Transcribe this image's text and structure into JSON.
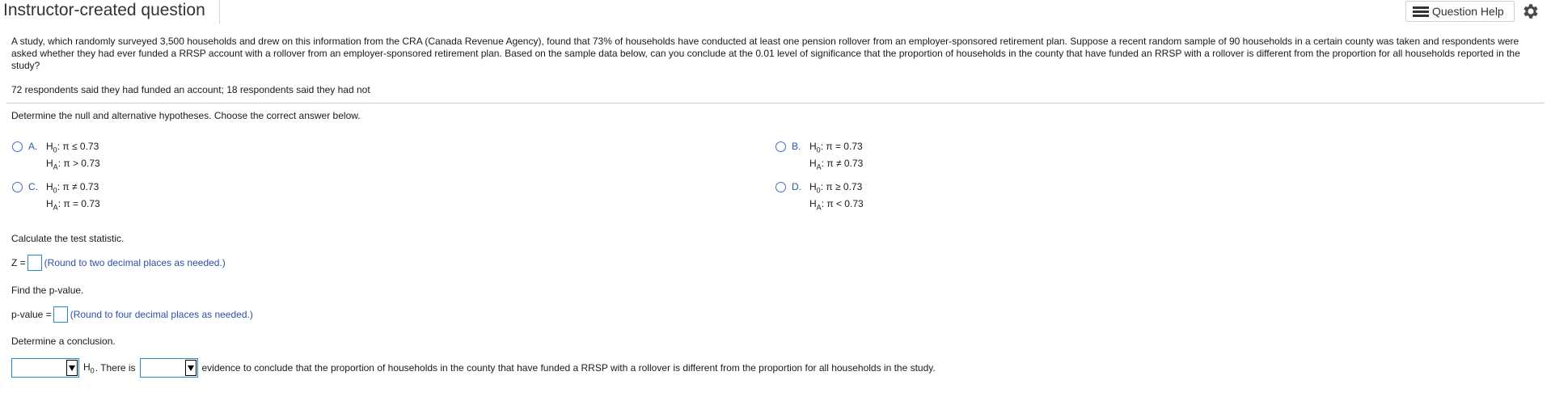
{
  "header": {
    "title": "Instructor-created question",
    "help_label": "Question Help",
    "help_icon": "list-icon",
    "settings_icon": "gear-icon"
  },
  "question": {
    "text": "A study, which randomly surveyed 3,500 households and drew on this information from the CRA (Canada Revenue Agency), found that 73% of households have conducted at least one pension rollover from an employer-sponsored retirement plan. Suppose a recent random sample of 90 households in a certain county was taken and respondents were asked whether they had ever funded a RRSP account with a rollover from an employer-sponsored retirement plan. Based on the sample data below, can you conclude at the 0.01 level of significance that the proportion of households in the county that have funded an RRSP with a rollover is different from the proportion for all households reported in the study?",
    "data_line": "72 respondents said they had funded an account; 18 respondents said they had not"
  },
  "part1": {
    "prompt": "Determine the null and alternative hypotheses. Choose the correct answer below.",
    "options": [
      {
        "letter": "A.",
        "h0_label": "H",
        "h0_sub": "0",
        "h0_rel": ": π ≤ 0.73",
        "ha_label": "H",
        "ha_sub": "A",
        "ha_rel": ": π > 0.73"
      },
      {
        "letter": "B.",
        "h0_label": "H",
        "h0_sub": "0",
        "h0_rel": ": π = 0.73",
        "ha_label": "H",
        "ha_sub": "A",
        "ha_rel": ": π ≠ 0.73"
      },
      {
        "letter": "C.",
        "h0_label": "H",
        "h0_sub": "0",
        "h0_rel": ": π ≠ 0.73",
        "ha_label": "H",
        "ha_sub": "A",
        "ha_rel": ": π = 0.73"
      },
      {
        "letter": "D.",
        "h0_label": "H",
        "h0_sub": "0",
        "h0_rel": ": π ≥ 0.73",
        "ha_label": "H",
        "ha_sub": "A",
        "ha_rel": ": π < 0.73"
      }
    ]
  },
  "part2": {
    "prompt": "Calculate the test statistic.",
    "label": "Z =",
    "hint": "(Round to two decimal places as needed.)"
  },
  "part3": {
    "prompt": "Find the p-value.",
    "label": "p-value =",
    "hint": "(Round to four decimal places as needed.)"
  },
  "part4": {
    "prompt": "Determine a conclusion.",
    "h_label": "H",
    "h_sub": "0",
    "mid_text": ". There is",
    "tail_text": "evidence to conclude that the proportion of households in the county that have funded a RRSP with a rollover is different from the proportion for all households in the study."
  },
  "colors": {
    "accent_blue": "#2b59a8",
    "input_border": "#1f8fc6"
  }
}
